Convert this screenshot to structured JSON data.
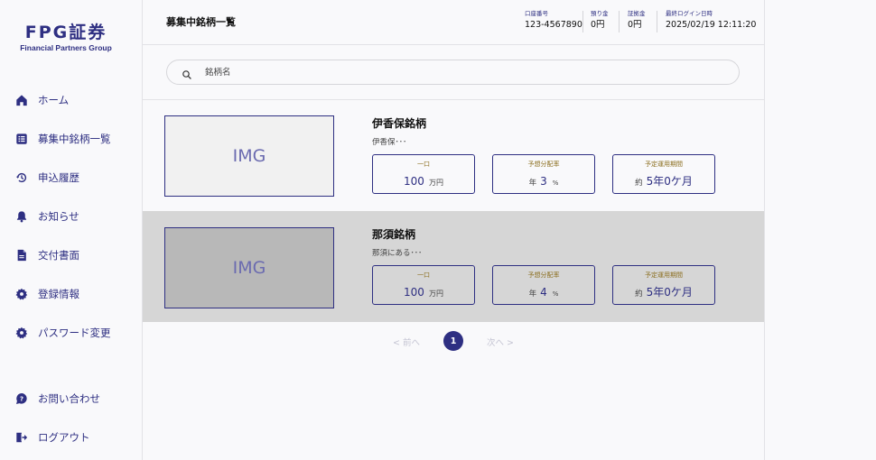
{
  "brand": {
    "name": "FPG証券",
    "tagline": "Financial Partners Group"
  },
  "nav": [
    {
      "label": "ホーム",
      "icon": "home-icon"
    },
    {
      "label": "募集中銘柄一覧",
      "icon": "list-icon"
    },
    {
      "label": "申込履歴",
      "icon": "history-icon"
    },
    {
      "label": "お知らせ",
      "icon": "bell-icon"
    },
    {
      "label": "交付書面",
      "icon": "document-icon"
    },
    {
      "label": "登録情報",
      "icon": "gear-icon"
    },
    {
      "label": "パスワード変更",
      "icon": "gear-icon"
    },
    {
      "label": "お問い合わせ",
      "icon": "chat-help-icon"
    },
    {
      "label": "ログアウト",
      "icon": "logout-icon"
    }
  ],
  "header": {
    "title": "募集中銘柄一覧",
    "account": [
      {
        "label": "口座番号",
        "value": "123-4567890"
      },
      {
        "label": "預り金",
        "value": "0円"
      },
      {
        "label": "証拠金",
        "value": "0円"
      },
      {
        "label": "最終ログイン日時",
        "value": "2025/02/19 12:11:20"
      }
    ]
  },
  "search": {
    "placeholder": "銘柄名",
    "value": ""
  },
  "funds": [
    {
      "image_label": "IMG",
      "name": "伊香保銘柄",
      "description": "伊香保･･･",
      "unit": {
        "label": "一口",
        "value": "100",
        "suffix": "万円"
      },
      "yield": {
        "label": "予想分配率",
        "prefix": "年",
        "value": "3",
        "suffix": "%"
      },
      "term": {
        "label": "予定運用期間",
        "prefix": "約",
        "value": "5年0ケ月"
      }
    },
    {
      "image_label": "IMG",
      "name": "那須銘柄",
      "description": "那須にある･･･",
      "unit": {
        "label": "一口",
        "value": "100",
        "suffix": "万円"
      },
      "yield": {
        "label": "予想分配率",
        "prefix": "年",
        "value": "4",
        "suffix": "%"
      },
      "term": {
        "label": "予定運用期間",
        "prefix": "約",
        "value": "5年0ケ月"
      }
    }
  ],
  "pagination": {
    "prev": "< 前へ",
    "current": "1",
    "next": "次へ >"
  },
  "colors": {
    "accent": "#2e2f82",
    "label_gold": "#8a6d1d",
    "selected_row": "#d6d6d6"
  }
}
